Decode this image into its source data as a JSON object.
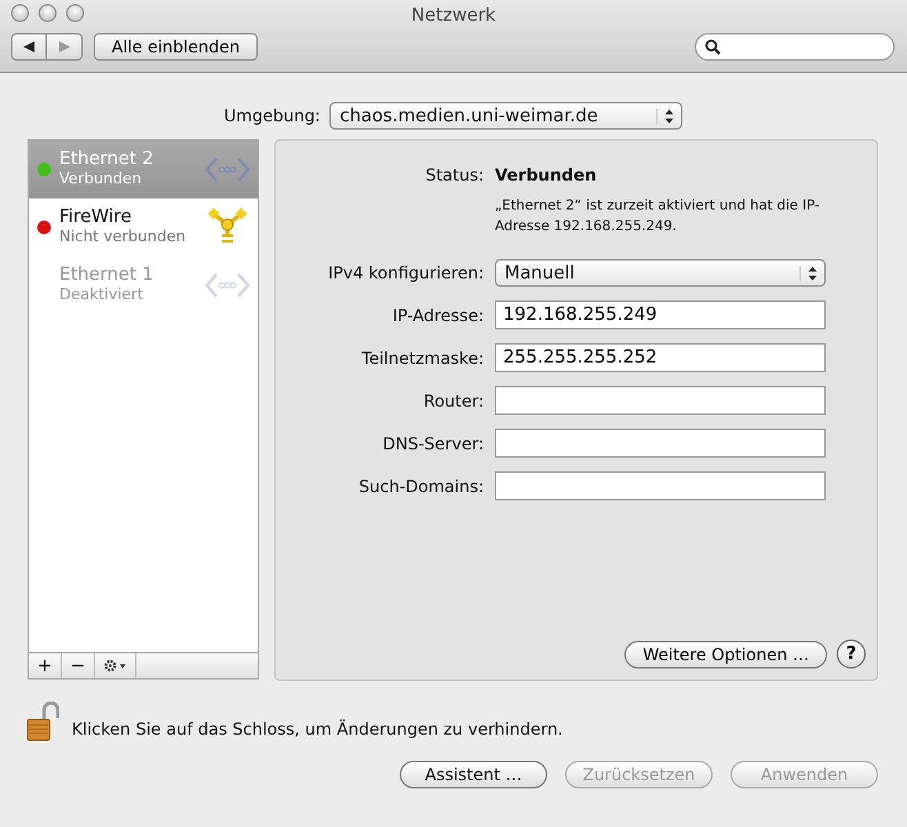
{
  "window": {
    "title": "Netzwerk"
  },
  "toolbar": {
    "show_all": "Alle einblenden"
  },
  "location": {
    "label": "Umgebung:",
    "value": "chaos.medien.uni-weimar.de"
  },
  "services": [
    {
      "name": "Ethernet 2",
      "status": "Verbunden",
      "color": "#3fbf1a",
      "selected": true,
      "disabled": false,
      "kind": "ethernet"
    },
    {
      "name": "FireWire",
      "status": "Nicht verbunden",
      "color": "#d81010",
      "selected": false,
      "disabled": false,
      "kind": "firewire"
    },
    {
      "name": "Ethernet 1",
      "status": "Deaktiviert",
      "selected": false,
      "disabled": true,
      "kind": "ethernet"
    }
  ],
  "list_controls": [
    "+",
    "−"
  ],
  "status": {
    "label": "Status:",
    "value": "Verbunden",
    "description": "„Ethernet 2“ ist zurzeit aktiviert und hat die IP-Adresse 192.168.255.249."
  },
  "fields": [
    {
      "kind": "popup",
      "label": "IPv4 konfigurieren:",
      "value": "Manuell"
    },
    {
      "kind": "text",
      "label": "IP-Adresse:",
      "value": "192.168.255.249"
    },
    {
      "kind": "text",
      "label": "Teilnetzmaske:",
      "value": "255.255.255.252"
    },
    {
      "kind": "text",
      "label": "Router:"
    },
    {
      "kind": "text",
      "label": "DNS-Server:"
    },
    {
      "kind": "text",
      "label": "Such-Domains:"
    }
  ],
  "advanced_button": "Weitere Optionen …",
  "help_button": "?",
  "lock_text": "Klicken Sie auf das Schloss, um Änderungen zu verhindern.",
  "buttons": [
    {
      "label": "Assistent …",
      "disabled": false
    },
    {
      "label": "Zurücksetzen",
      "disabled": true
    },
    {
      "label": "Anwenden",
      "disabled": true
    }
  ]
}
